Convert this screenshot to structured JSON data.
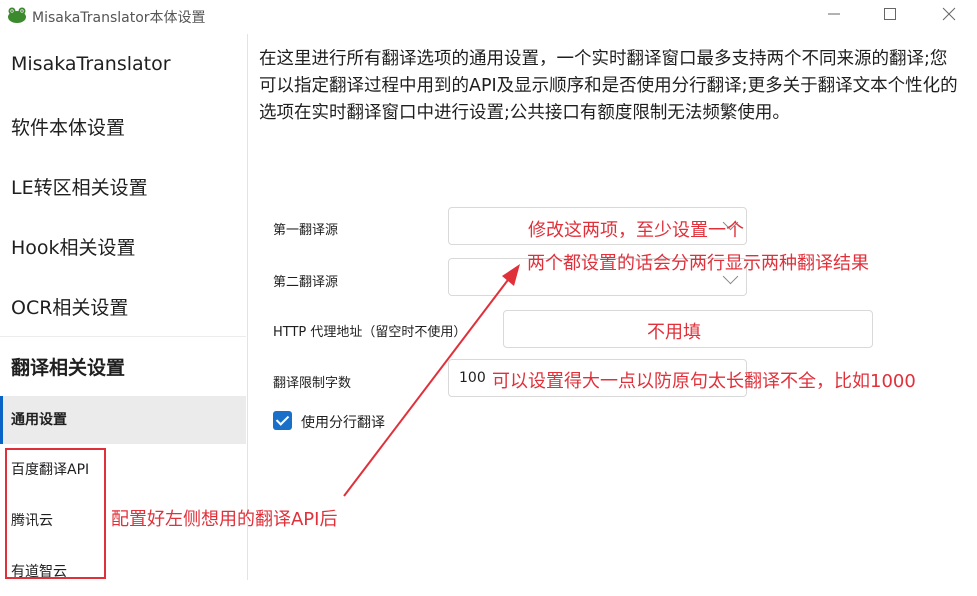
{
  "window": {
    "title": "MisakaTranslator本体设置",
    "min_icon": "minimize-icon",
    "max_icon": "maximize-icon",
    "close_icon": "close-icon"
  },
  "sidebar": {
    "items": [
      {
        "label": "MisakaTranslator"
      },
      {
        "label": "软件本体设置"
      },
      {
        "label": "LE转区相关设置"
      },
      {
        "label": "Hook相关设置"
      },
      {
        "label": "OCR相关设置"
      },
      {
        "label": "翻译相关设置"
      }
    ],
    "sub_items": [
      {
        "label": "通用设置"
      },
      {
        "label": "百度翻译API"
      },
      {
        "label": "腾讯云"
      },
      {
        "label": "有道智云"
      }
    ]
  },
  "main": {
    "description": "在这里进行所有翻译选项的通用设置，一个实时翻译窗口最多支持两个不同来源的翻译;您可以指定翻译过程中用到的API及显示顺序和是否使用分行翻译;更多关于翻译文本个性化的选项在实时翻译窗口中进行设置;公共接口有额度限制无法频繁使用。",
    "first_source_label": "第一翻译源",
    "second_source_label": "第二翻译源",
    "proxy_label": "HTTP 代理地址（留空时不使用）",
    "limit_label": "翻译限制字数",
    "limit_value": "100",
    "split_label": "使用分行翻译",
    "split_checked": true
  },
  "annotations": {
    "a1": "修改这两项，至少设置一个",
    "a2": "两个都设置的话会分两行显示两种翻译结果",
    "a3": "不用填",
    "a4": "可以设置得大一点以防原句太长翻译不全，比如1000",
    "a5": "配置好左侧想用的翻译API后",
    "color": "#e0313b"
  }
}
